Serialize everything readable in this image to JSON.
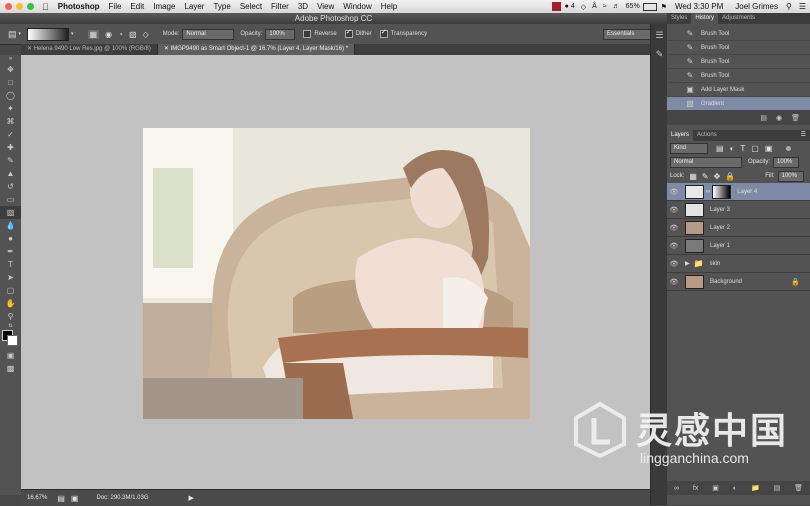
{
  "menubar": {
    "app": "Photoshop",
    "items": [
      "File",
      "Edit",
      "Image",
      "Layer",
      "Type",
      "Select",
      "Filter",
      "3D",
      "View",
      "Window",
      "Help"
    ],
    "status": {
      "badge": "4",
      "battery": "65%",
      "clock": "Wed 3:30 PM",
      "user": "Joel Grimes"
    }
  },
  "window": {
    "title": "Adobe Photoshop CC"
  },
  "options": {
    "mode_label": "Mode:",
    "mode_value": "Normal",
    "opacity_label": "Opacity:",
    "opacity_value": "100%",
    "reverse": "Reverse",
    "dither": "Dither",
    "transparency": "Transparency",
    "workspace": "Essentials"
  },
  "doc_tabs": [
    {
      "label": "Helena 9490 Low Res.jpg @ 100% (RGB/8)"
    },
    {
      "label": "IMGP9490 as Smart Object-1 @ 16.7% (Layer 4, Layer Mask/16) *"
    }
  ],
  "status_bar": {
    "zoom": "16.67%",
    "doc": "Doc: 290.3M/1.03G"
  },
  "panels": {
    "top_tabs": [
      "Styles",
      "History",
      "Adjustments"
    ],
    "history": [
      {
        "label": "Brush Tool",
        "icon": "brush-icon"
      },
      {
        "label": "Brush Tool",
        "icon": "brush-icon"
      },
      {
        "label": "Brush Tool",
        "icon": "brush-icon"
      },
      {
        "label": "Brush Tool",
        "icon": "brush-icon"
      },
      {
        "label": "Add Layer Mask",
        "icon": "layer-mask-icon"
      },
      {
        "label": "Gradient",
        "icon": "gradient-icon"
      }
    ],
    "layers_tabs": [
      "Layers",
      "Actions"
    ],
    "filter_kind": "Kind",
    "blend_mode": "Normal",
    "opacity_label": "Opacity:",
    "opacity_value": "100%",
    "lock_label": "Lock:",
    "fill_label": "Fill:",
    "fill_value": "100%",
    "layers": [
      {
        "name": "Layer 4",
        "thumb": "#e8e8e8"
      },
      {
        "name": "Layer 3",
        "thumb": "#e4e4e4"
      },
      {
        "name": "Layer 2",
        "thumb": "#b79a86"
      },
      {
        "name": "Layer 1",
        "thumb": "#7a7a7a"
      },
      {
        "name": "skin",
        "thumb": "#6e6e6e"
      },
      {
        "name": "Background",
        "thumb": "#b79a86"
      }
    ]
  },
  "watermark": {
    "brand_cn": "灵感中国",
    "url": "lingganchina.com"
  },
  "colors": {
    "selection": "#7f8ba6",
    "canvas": "#c2c2c2"
  }
}
